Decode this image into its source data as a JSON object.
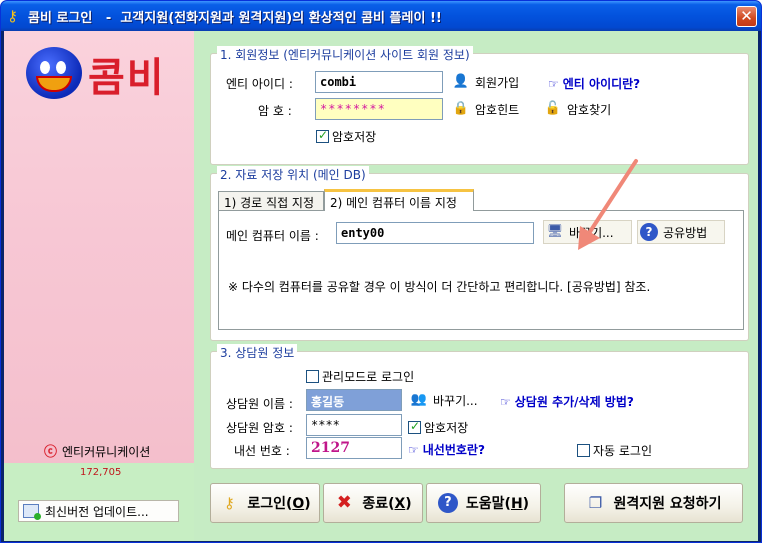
{
  "window": {
    "title": "콤비 로그인   -  고객지원(전화지원과 원격지원)의 환상적인 콤비 플레이 !!",
    "close_label": "✕"
  },
  "left": {
    "logo_text": "콤비",
    "company_symbol": "ⓒ",
    "company_name": "엔티커뮤니케이션",
    "version_number": "172,705",
    "update_button": "최신버전 업데이트..."
  },
  "member": {
    "group_label": "1. 회원정보 (엔티커뮤니케이션 사이트 회원 정보)",
    "entity_id_label": "엔티 아이디 :",
    "entity_id_value": "combi",
    "password_label": "암   호 :",
    "password_value": "********",
    "signup_button": "회원가입",
    "entity_id_help_link": "엔티 아이디란?",
    "password_hint_button": "암호힌트",
    "find_password_button": "암호찾기",
    "save_password_label": "암호저장",
    "save_password_checked": true
  },
  "storage": {
    "group_label": "2. 자료 저장 위치 (메인 DB)",
    "tabs": [
      {
        "label": "1) 경로 직접 지정"
      },
      {
        "label": "2) 메인 컴퓨터 이름 지정"
      }
    ],
    "main_computer_label": "메인 컴퓨터 이름 :",
    "main_computer_value": "enty00",
    "change_button": "바꾸기...",
    "share_method_button": "공유방법",
    "note": "※ 다수의 컴퓨터를 공유할 경우 이 방식이 더 간단하고 편리합니다. [공유방법] 참조."
  },
  "agent": {
    "group_label": "3. 상담원 정보",
    "admin_mode_label": "관리모드로 로그인",
    "admin_mode_checked": false,
    "agent_name_label": "상담원 이름 :",
    "agent_name_value": "홍길동",
    "change_button": "바꾸기...",
    "add_remove_link": "상담원 추가/삭제 방법?",
    "agent_password_label": "상담원 암호 :",
    "agent_password_value": "****",
    "save_password_label": "암호저장",
    "save_password_checked": true,
    "extension_label": "내선 번호 :",
    "extension_value": "2127",
    "extension_help_link": "내선번호란?",
    "auto_login_label": "자동 로그인",
    "auto_login_checked": false
  },
  "buttons": {
    "login": "로그인(",
    "login_key": "O",
    "exit": "종료(",
    "exit_key": "X",
    "help": "도움말(",
    "help_key": "H",
    "close_paren": ")",
    "remote_support": "원격지원 요청하기"
  },
  "colors": {
    "title_blue": "#0352DD",
    "group_label_blue": "#1C3D9E",
    "link_blue": "#0000C8",
    "logo_red": "#D91E2B",
    "left_pink": "#F7C7D4",
    "panel_green": "#C6ECC4",
    "arrow_salmon": "#F08878"
  }
}
